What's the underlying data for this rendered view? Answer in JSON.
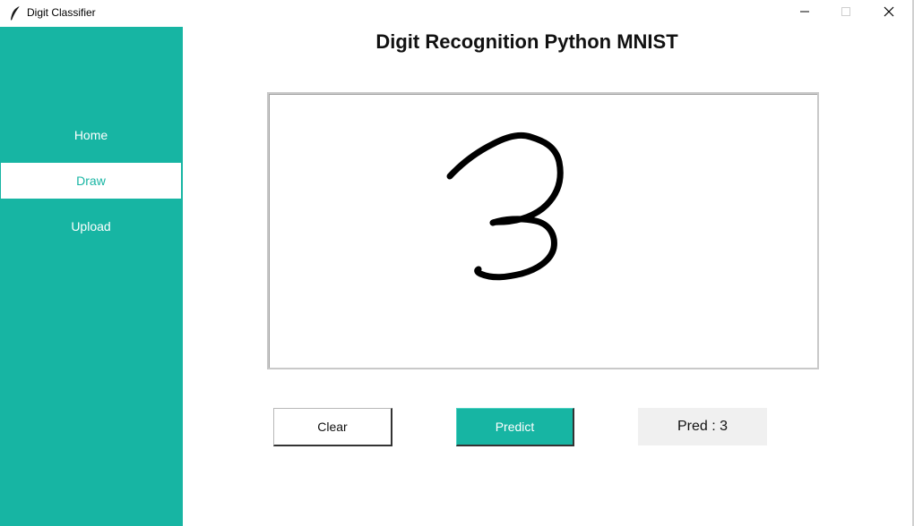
{
  "window": {
    "title": "Digit Classifier",
    "app_icon": "feather-icon",
    "controls": {
      "minimize_icon": "minimize-icon",
      "maximize_icon": "maximize-icon",
      "close_icon": "close-icon"
    }
  },
  "sidebar": {
    "background": "#17b5a3",
    "items": [
      {
        "label": "Home",
        "active": false
      },
      {
        "label": "Draw",
        "active": true
      },
      {
        "label": "Upload",
        "active": false
      }
    ]
  },
  "main": {
    "title": "Digit Recognition Python MNIST",
    "canvas": {
      "drawn_digit": "3",
      "stroke_color": "#000000"
    },
    "buttons": {
      "clear_label": "Clear",
      "predict_label": "Predict"
    },
    "prediction_label": "Pred : 3"
  },
  "colors": {
    "accent": "#17b5a3",
    "text": "#111111",
    "label_bg": "#f0f0f0"
  }
}
